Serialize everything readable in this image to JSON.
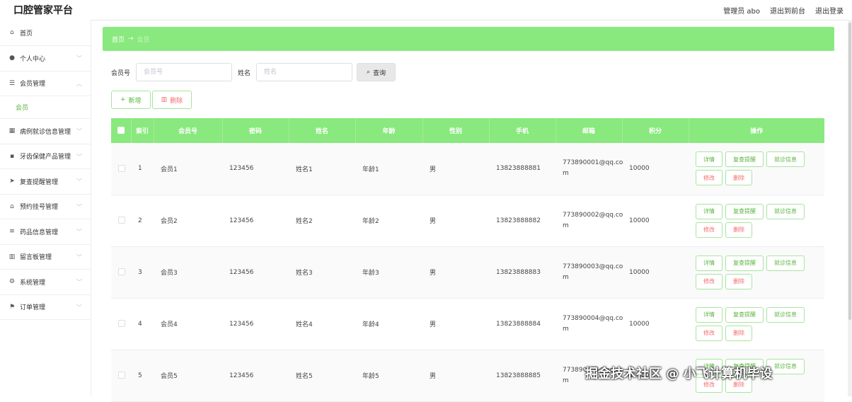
{
  "app": {
    "title": "口腔管家平台"
  },
  "topbar": {
    "user": "管理员 abo",
    "front": "退出到前台",
    "logout": "退出登录"
  },
  "sidebar": {
    "items": [
      {
        "label": "首页",
        "icon": "home-icon",
        "glyph": "⌂"
      },
      {
        "label": "个人中心",
        "icon": "user-icon",
        "glyph": "●"
      },
      {
        "label": "会员管理",
        "icon": "filter-icon",
        "glyph": "☰"
      },
      {
        "label": "病例就诊信息管理",
        "icon": "grid-icon",
        "glyph": "▦"
      },
      {
        "label": "牙齿保健产品管理",
        "icon": "apps-icon",
        "glyph": "▪"
      },
      {
        "label": "复查提醒管理",
        "icon": "send-icon",
        "glyph": "➤"
      },
      {
        "label": "预约挂号管理",
        "icon": "bank-icon",
        "glyph": "⌂"
      },
      {
        "label": "药品信息管理",
        "icon": "list-icon",
        "glyph": "≡"
      },
      {
        "label": "留言板管理",
        "icon": "trash-icon",
        "glyph": "▥"
      },
      {
        "label": "系统管理",
        "icon": "settings-icon",
        "glyph": "⚙"
      },
      {
        "label": "订单管理",
        "icon": "flag-icon",
        "glyph": "⚑"
      }
    ],
    "sub_member": "会员"
  },
  "breadcrumb": {
    "home": "首页",
    "arrow": "→",
    "current": "会员"
  },
  "search": {
    "member_no_label": "会员号",
    "member_no_placeholder": "会员号",
    "name_label": "姓名",
    "name_placeholder": "姓名",
    "query": "查询"
  },
  "actions": {
    "add": "新增",
    "delete": "删除"
  },
  "table": {
    "headers": [
      "",
      "索引",
      "会员号",
      "密码",
      "姓名",
      "年龄",
      "性别",
      "手机",
      "邮箱",
      "积分",
      "操作"
    ],
    "rows": [
      {
        "idx": "1",
        "no": "会员1",
        "pwd": "123456",
        "name": "姓名1",
        "age": "年龄1",
        "sex": "男",
        "phone": "13823888881",
        "email1": "773890001@qq.co",
        "email2": "m",
        "points": "10000"
      },
      {
        "idx": "2",
        "no": "会员2",
        "pwd": "123456",
        "name": "姓名2",
        "age": "年龄2",
        "sex": "男",
        "phone": "13823888882",
        "email1": "773890002@qq.co",
        "email2": "m",
        "points": "10000"
      },
      {
        "idx": "3",
        "no": "会员3",
        "pwd": "123456",
        "name": "姓名3",
        "age": "年龄3",
        "sex": "男",
        "phone": "13823888883",
        "email1": "773890003@qq.co",
        "email2": "m",
        "points": "10000"
      },
      {
        "idx": "4",
        "no": "会员4",
        "pwd": "123456",
        "name": "姓名4",
        "age": "年龄4",
        "sex": "男",
        "phone": "13823888884",
        "email1": "773890004@qq.co",
        "email2": "m",
        "points": "10000"
      },
      {
        "idx": "5",
        "no": "会员5",
        "pwd": "123456",
        "name": "姓名5",
        "age": "年龄5",
        "sex": "男",
        "phone": "13823888885",
        "email1": "773890005@qq.co",
        "email2": "m",
        "points": "10000"
      }
    ],
    "ops": {
      "detail": "详情",
      "recheck": "复查提醒",
      "visit": "就诊信息",
      "edit": "修改",
      "remove": "删除"
    }
  },
  "watermark": "掘金技术社区 @ 小飞计算机毕设",
  "colors": {
    "accent": "#89e87e",
    "green_text": "#5ab53e",
    "danger": "#f56c6c"
  }
}
